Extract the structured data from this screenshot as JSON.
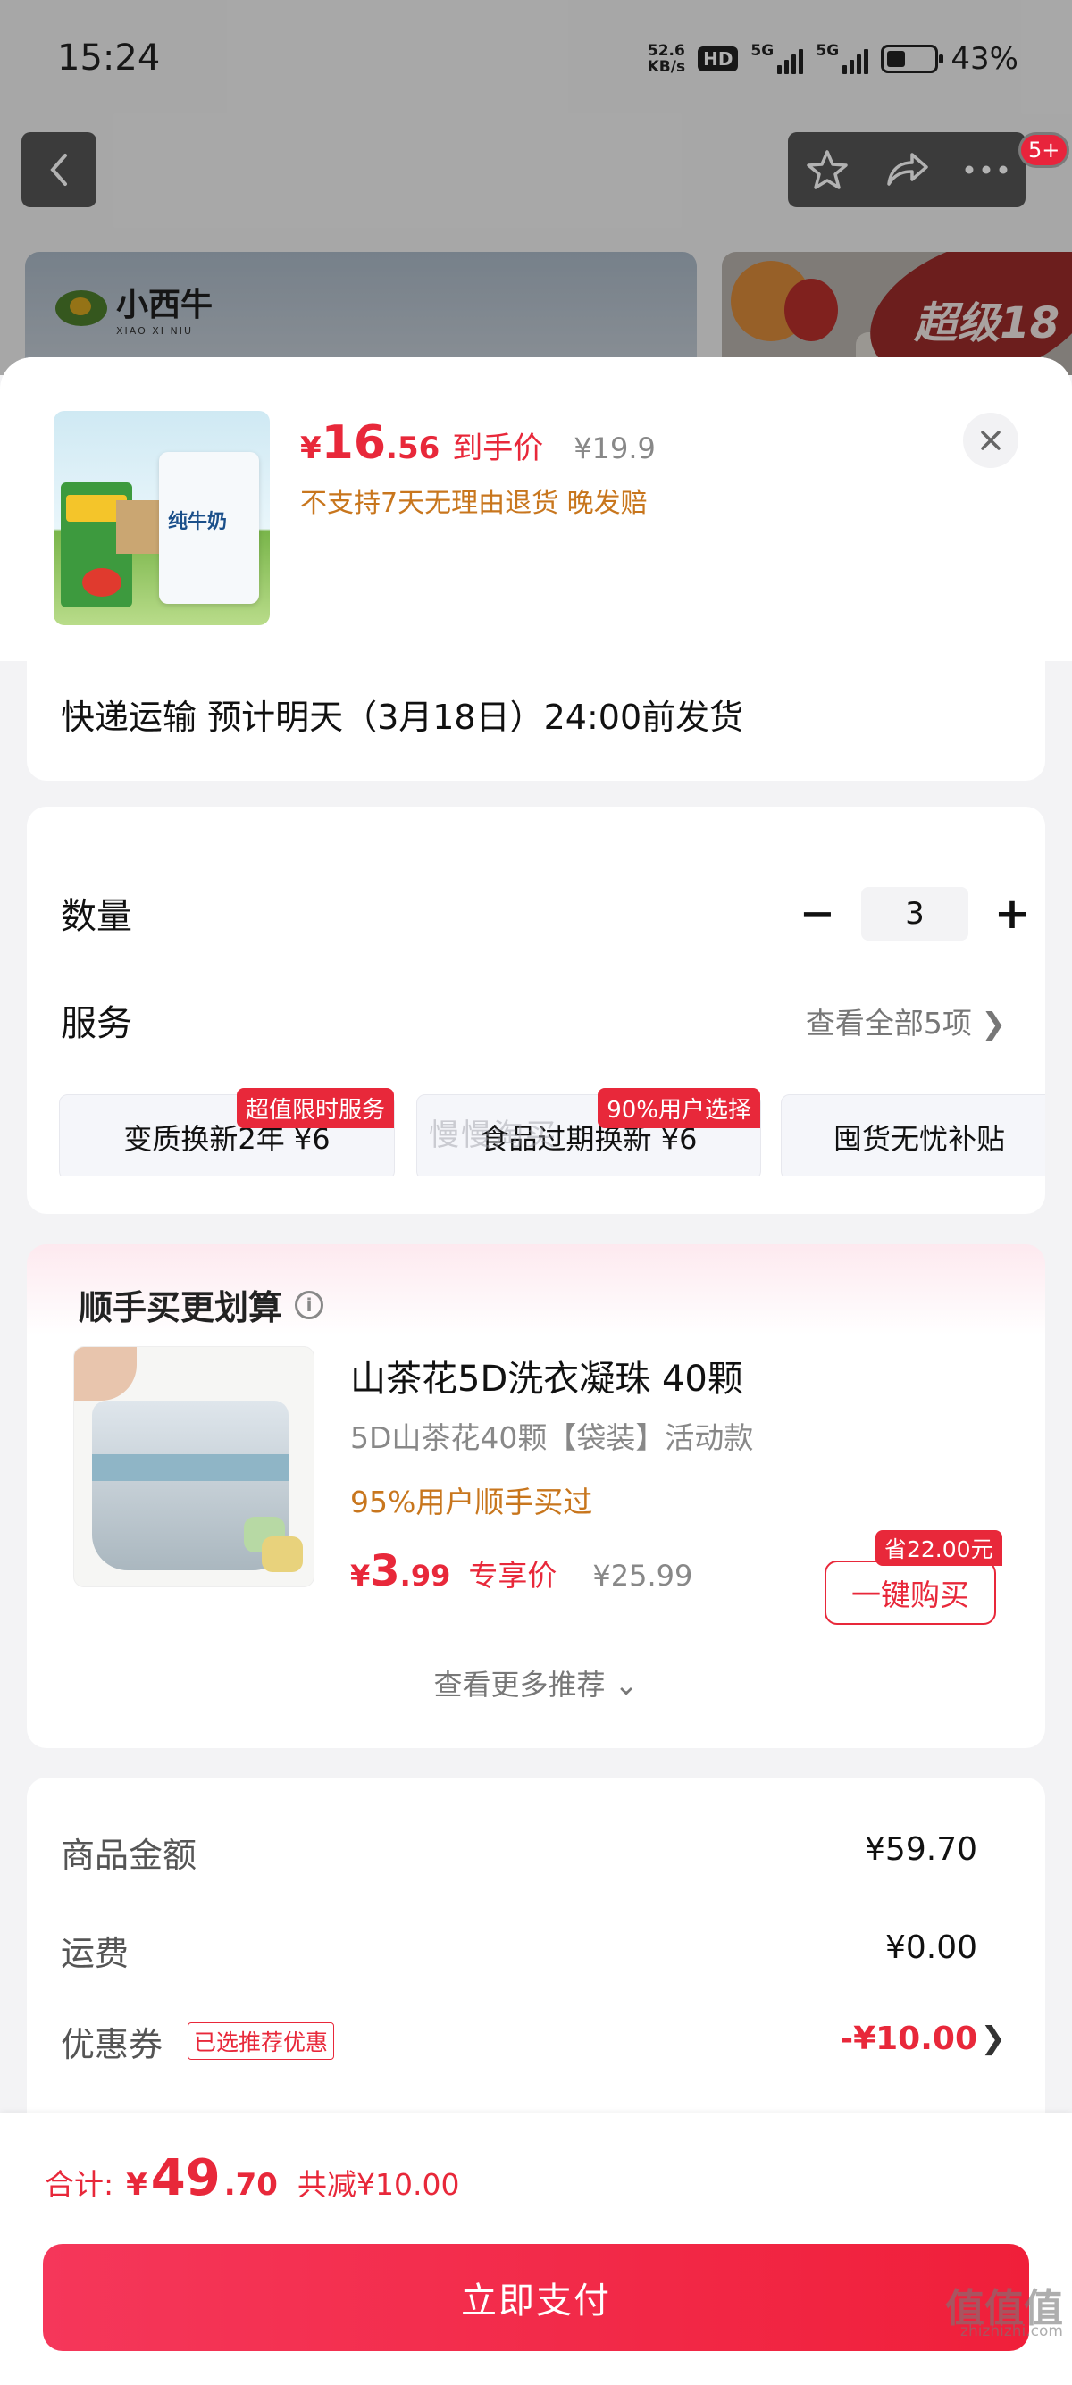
{
  "status_bar": {
    "time": "15:24",
    "net_speed_top": "52.6",
    "net_speed_bottom": "KB/s",
    "hd": "HD",
    "sig1": "5G",
    "sig2": "5G",
    "battery_pct": "43%"
  },
  "background": {
    "badge_count": "5+",
    "promo_text": "超级18"
  },
  "product": {
    "price_symbol": "¥",
    "price_int": "16",
    "price_dec": ".56",
    "price_tag": "到手价",
    "price_old": "¥19.9",
    "return_note": "不支持7天无理由退货 晚发赔",
    "thumb_label": "纯牛奶"
  },
  "shipping": {
    "text": "快递运输 预计明天（3月18日）24:00前发货"
  },
  "quantity": {
    "label": "数量",
    "value": "3",
    "minus": "−",
    "plus": "+"
  },
  "service": {
    "label": "服务",
    "view_all": "查看全部5项 ❯",
    "chips": [
      {
        "label": "变质换新2年  ¥6",
        "badge": "超值限时服务"
      },
      {
        "label": "食品过期换新  ¥6",
        "badge": "90%用户选择"
      },
      {
        "label": "囤货无忧补贴",
        "badge": ""
      }
    ],
    "watermark": "慢慢淘买"
  },
  "addon": {
    "title": "顺手买更划算",
    "name": "山茶花5D洗衣凝珠 40颗",
    "desc": "5D山茶花40颗【袋装】活动款",
    "stat": "95%用户顺手买过",
    "price_symbol": "¥",
    "price_int": "3",
    "price_dec": ".99",
    "price_tag": "专享价",
    "price_old": "¥25.99",
    "save_badge": "省22.00元",
    "buy_label": "一键购买",
    "more": "查看更多推荐 ⌄"
  },
  "summary": {
    "goods_label": "商品金额",
    "goods_value": "¥59.70",
    "freight_label": "运费",
    "freight_value": "¥0.00",
    "coupon_label": "优惠券",
    "coupon_tag": "已选推荐优惠",
    "coupon_value": "-¥10.00"
  },
  "footer": {
    "total_label": "合计:",
    "total_symbol": "¥",
    "total_int": "49",
    "total_dec": ".70",
    "total_saved": "共减¥10.00",
    "pay_label": "立即支付"
  },
  "corner_watermark": {
    "main": "值值值",
    "sub": "zhizhizhi.com"
  },
  "colors": {
    "accent_red": "#e8283a",
    "warning_orange": "#c8761d",
    "pay_button": "#f01f3a"
  }
}
